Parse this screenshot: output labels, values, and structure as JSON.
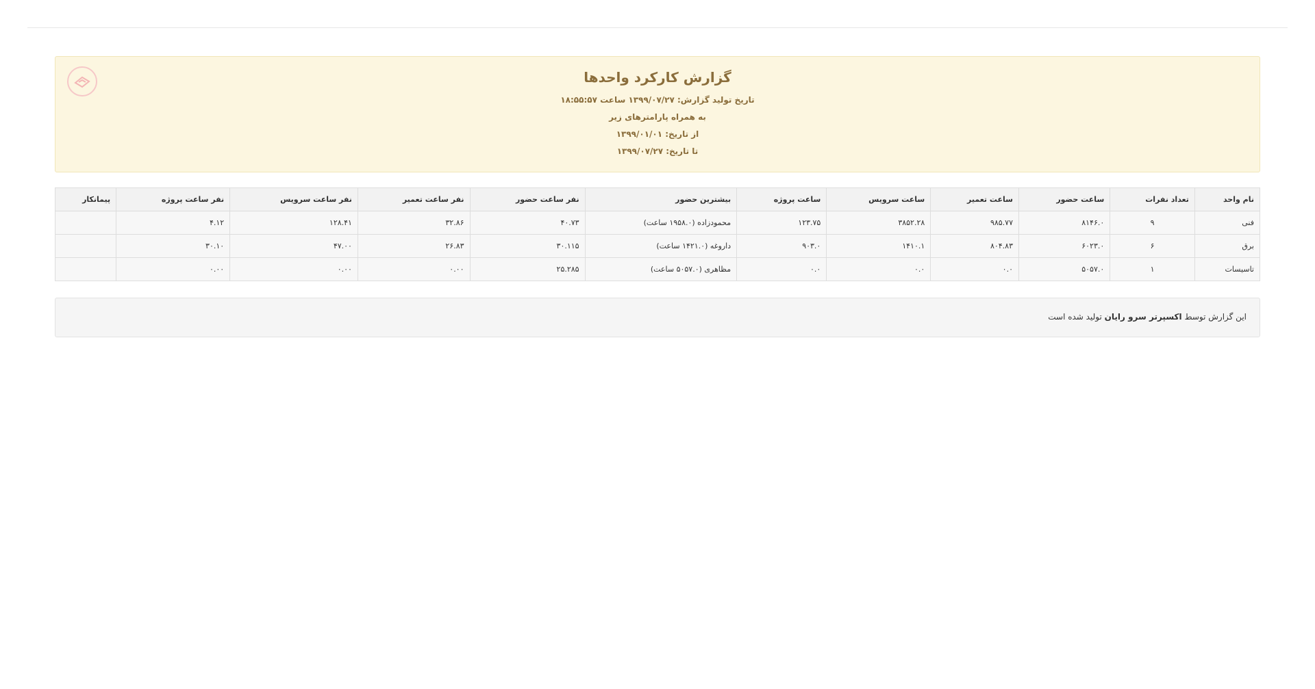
{
  "header": {
    "title": "گزارش کارکرد واحدها",
    "generated": "تاریخ تولید گزارش: ۱۳۹۹/۰۷/۲۷ ساعت ۱۸:۵۵:۵۷",
    "params_intro": "به همراه پارامترهای زیر",
    "from_date": "از تاریخ: ۱۳۹۹/۰۱/۰۱",
    "to_date": "تا تاریخ: ۱۳۹۹/۰۷/۲۷",
    "logo_icon": "company-logo-icon",
    "colors": {
      "panel_bg": "#fcf6e0",
      "title_text": "#8a6d3b"
    }
  },
  "table": {
    "headers": [
      "نام واحد",
      "تعداد نفرات",
      "ساعت حضور",
      "ساعت تعمیر",
      "ساعت سرویس",
      "ساعت پروژه",
      "بیشترین حضور",
      "نفر ساعت حضور",
      "نفر ساعت تعمیر",
      "نفر ساعت سرویس",
      "نفر ساعت پروژه",
      "پیمانکار"
    ],
    "rows": [
      [
        "فنی",
        "۹",
        "۸۱۴۶.۰",
        "۹۸۵.۷۷",
        "۳۸۵۲.۲۸",
        "۱۲۳.۷۵",
        "محمودزاده (۱۹۵۸.۰ ساعت)",
        "۴۰.۷۳",
        "۳۲.۸۶",
        "۱۲۸.۴۱",
        "۴.۱۲",
        ""
      ],
      [
        "برق",
        "۶",
        "۶۰۲۳.۰",
        "۸۰۴.۸۳",
        "۱۴۱۰.۱",
        "۹۰۳.۰",
        "داروغه (۱۴۲۱.۰ ساعت)",
        "۳۰.۱۱۵",
        "۲۶.۸۳",
        "۴۷.۰۰",
        "۳۰.۱۰",
        ""
      ],
      [
        "تاسیسات",
        "۱",
        "۵۰۵۷.۰",
        "۰.۰",
        "۰.۰",
        "۰.۰",
        "مظاهری (۵۰۵۷.۰ ساعت)",
        "۲۵.۲۸۵",
        "۰.۰۰",
        "۰.۰۰",
        "۰.۰۰",
        ""
      ]
    ]
  },
  "footer": {
    "text_before": "این گزارش توسط",
    "brand": "اکسپرتر سرو رایان",
    "text_after": "تولید شده است"
  }
}
